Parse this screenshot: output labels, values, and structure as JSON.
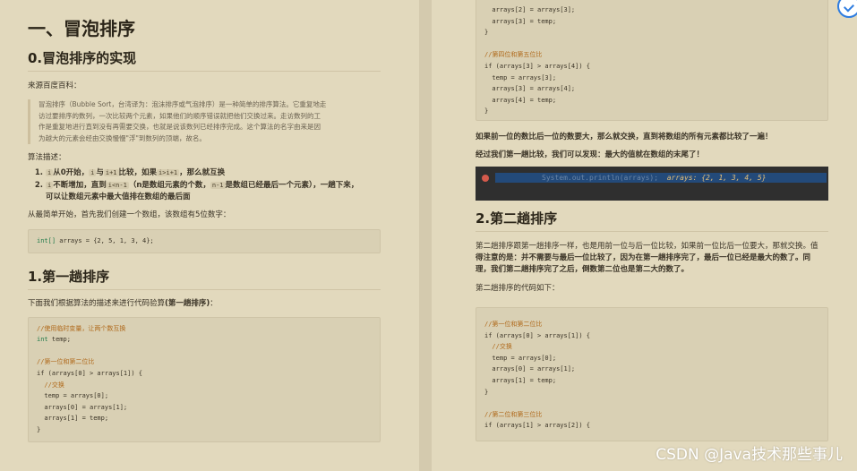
{
  "left": {
    "title": "一、冒泡排序",
    "section0": "0.冒泡排序的实现",
    "source_label": "来源百度百科：",
    "quote": [
      "冒泡排序（Bubble Sort，台湾译为：泡沫排序或气泡排序）是一种简单的排序算法。它重复地走",
      "访过要排序的数列，一次比较两个元素，如果他们的顺序错误就把他们交换过来。走访数列的工",
      "作是重复地进行直到没有再需要交换，也就是说该数列已经排序完成。这个算法的名字由来是因",
      "为越大的元素会经由交换慢慢\"浮\"到数列的顶端，故名。"
    ],
    "algo_label": "算法描述：",
    "steps": {
      "s1": {
        "code_i": "i",
        "t1": "从0开始，",
        "code_i2": "i",
        "t2": "与",
        "code_i1": "i+1",
        "t3": "比较，如果",
        "code_cmp": "i>i+1",
        "t4": "，那么就互换"
      },
      "s2": {
        "code_i": "i",
        "t1": "不断增加，直到",
        "code_n": "i<n-1",
        "t2": "（n是数组元素的个数，",
        "code_n1": "n-1",
        "t3": "是数组已经最后一个元素），一趟下来，",
        "t4": "可以让数组元素中最大值排在数组的最后面"
      }
    },
    "intro": "从最简单开始，首先我们创建一个数组，该数组有5位数字：",
    "decl_type": "int[]",
    "decl_rest": " arrays = {2, 5, 1, 3, 4};",
    "section1": "1.第一趟排序",
    "verify_pre": "下面我们根据算法的描述来进行代码验算",
    "verify_bold": "(第一趟排序)",
    "verify_post": "：",
    "code": {
      "c1": "//使用临时变量，让两个数互换",
      "decl_kw": "int",
      "decl_rest": " temp;",
      "c2": "//第一位和第二位比",
      "l1": "if (arrays[0] > arrays[1]) {",
      "c3": "  //交换",
      "l2": "  temp = arrays[0];",
      "l3": "  arrays[0] = arrays[1];",
      "l4": "  arrays[1] = temp;",
      "l5": "}"
    }
  },
  "right": {
    "top_code": {
      "l1": "  arrays[3] = temp;",
      "l2": "}",
      "c1": "//第四位和第五位比",
      "l3": "if (arrays[3] > arrays[4]) {",
      "l4": "  temp = arrays[3];",
      "l5": "  arrays[3] = arrays[4];",
      "l6": "  arrays[4] = temp;",
      "l7": "}"
    },
    "p1": "如果前一位的数比后一位的数要大，那么就交换，直到将数组的所有元素都比较了一遍！",
    "p2": "经过我们第一趟比较，我们可以发现：最大的值就在数组的末尾了！",
    "terminal_call": "System.out.println(arrays);",
    "terminal_out": "arrays: {2, 1, 3, 4, 5}",
    "section2": "2.第二趟排序",
    "p3": [
      "第二趟排序跟第一趟排序一样，也是用前一位与后一位比较，如果前一位比后一位要大，那就交换。值",
      "得注意的是：并不需要与最后一位比较了，因为在第一趟排序完了，最后一位已经是最大的数了。同",
      "理，我们第二趟排序完了之后，倒数第二位也是第二大的数了。"
    ],
    "p4": "第二趟排序的代码如下：",
    "code2": {
      "c1": "//第一位和第二位比",
      "l1": "if (arrays[0] > arrays[1]) {",
      "c2": "  //交换",
      "l2": "  temp = arrays[0];",
      "l3": "  arrays[0] = arrays[1];",
      "l4": "  arrays[1] = temp;",
      "l5": "}",
      "c3": "//第二位和第三位比",
      "l6": "if (arrays[1] > arrays[2]) {"
    }
  },
  "watermark": "CSDN @Java技术那些事儿"
}
